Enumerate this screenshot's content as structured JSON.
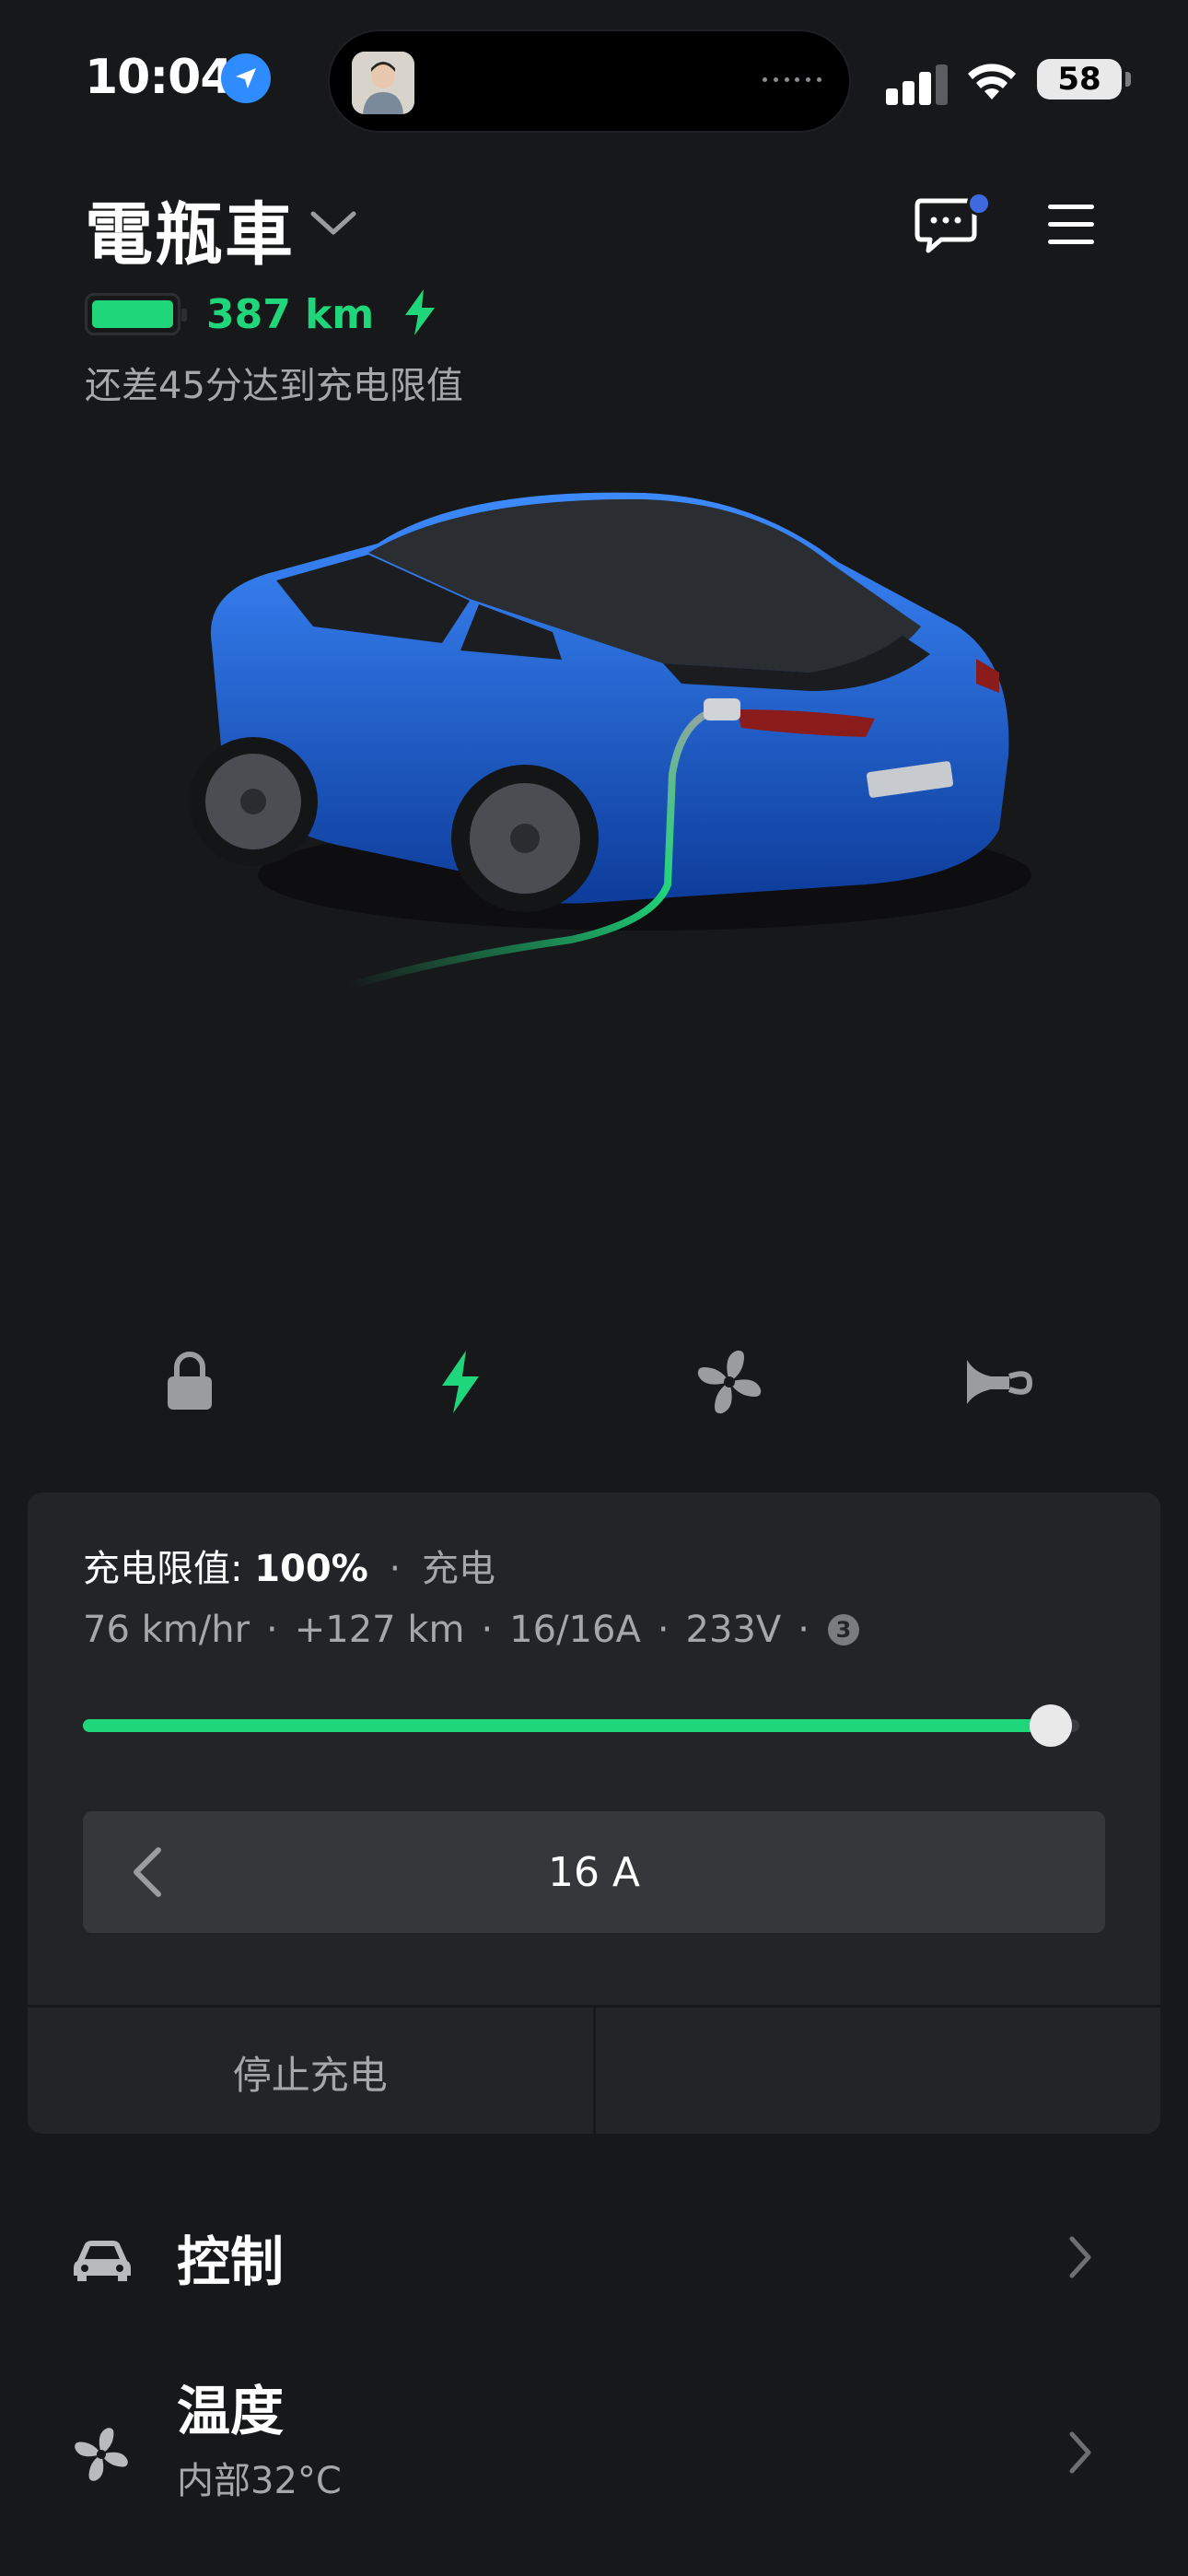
{
  "status_bar": {
    "time": "10:04",
    "battery_level": "58"
  },
  "header": {
    "vehicle_name": "電瓶車",
    "range": "387 km",
    "charge_eta": "还差45分达到充电限值"
  },
  "quick_actions": [
    {
      "icon": "lock-icon"
    },
    {
      "icon": "charge-bolt-icon",
      "active_color": "#1fd67a"
    },
    {
      "icon": "fan-icon"
    },
    {
      "icon": "horn-icon"
    }
  ],
  "charging": {
    "limit_label": "充电限值:",
    "limit_value": "100%",
    "dot": "·",
    "state": "充电",
    "rate": "76 km/hr",
    "added": "+127 km",
    "current": "16/16A",
    "voltage": "233V",
    "phases": "3",
    "limit_fraction": 1.0,
    "amps_setting": "16 A",
    "stop_label": "停止充电"
  },
  "menu": [
    {
      "title": "控制",
      "icon": "car-icon"
    },
    {
      "title": "温度",
      "subtitle": "内部32°C",
      "icon": "fan-icon"
    }
  ],
  "colors": {
    "background": "#17181a",
    "card": "#232427",
    "accent_green": "#1fd67a",
    "muted_text": "#a5a7ab"
  }
}
